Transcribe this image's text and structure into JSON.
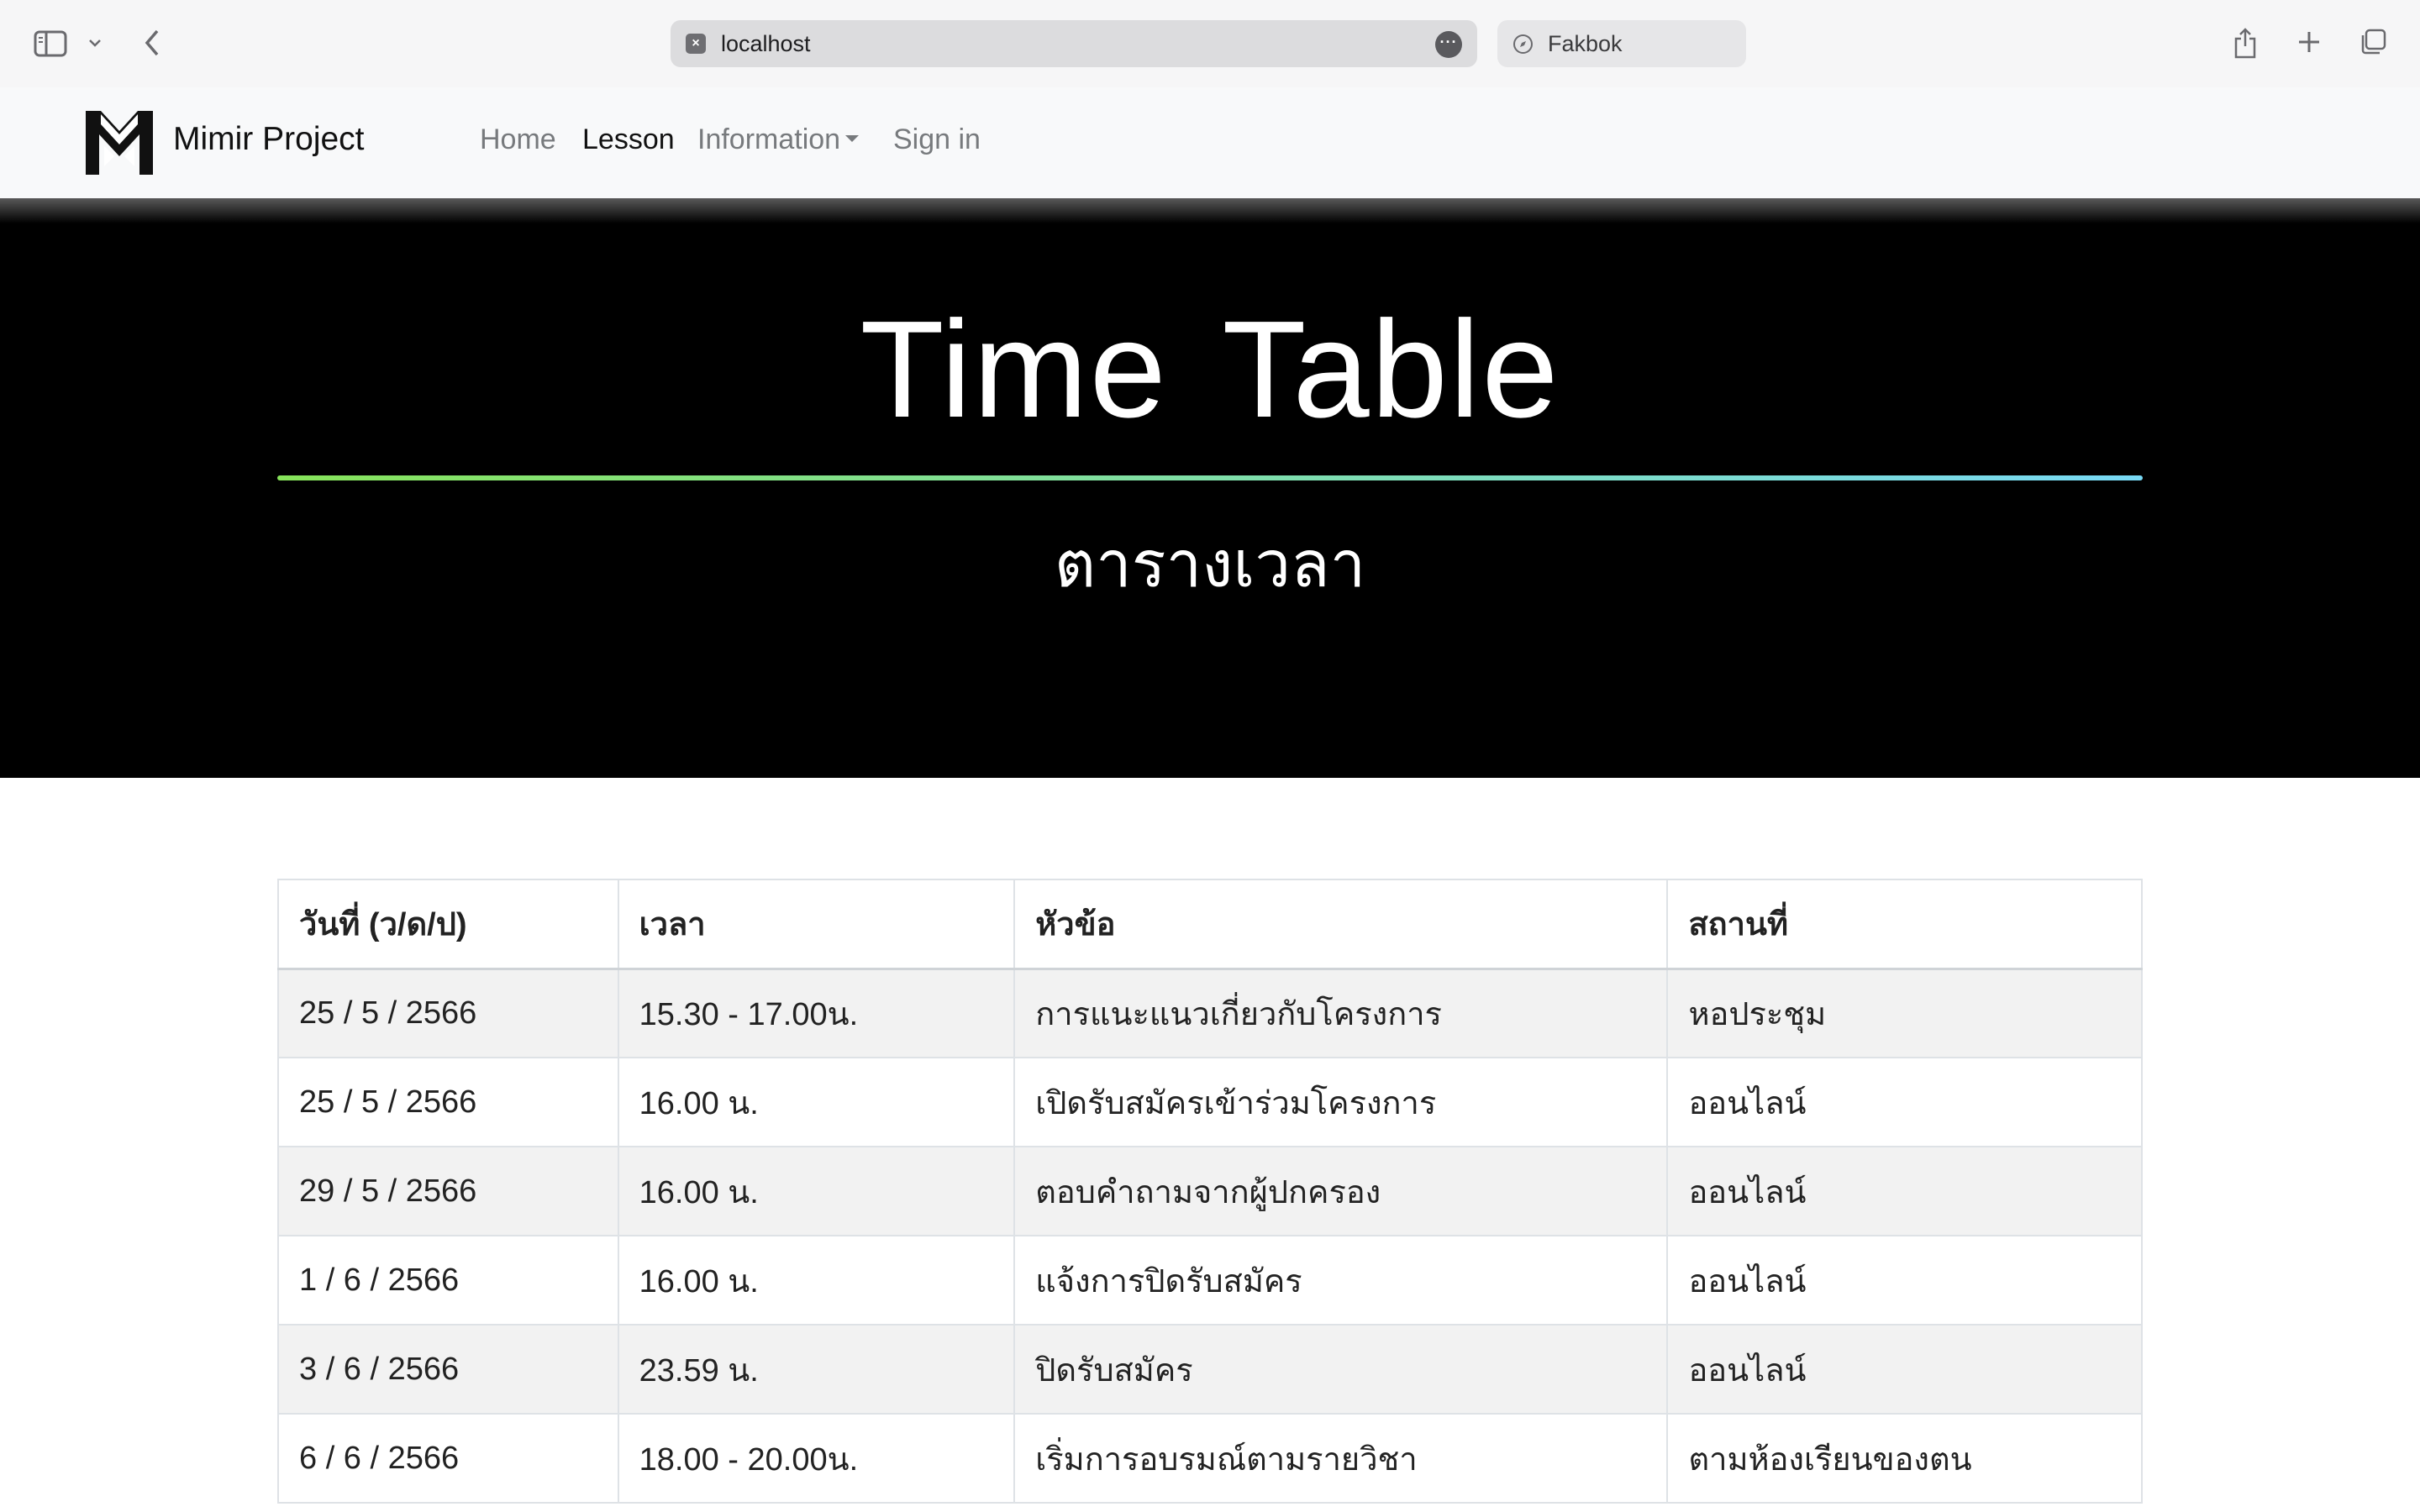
{
  "browser": {
    "url": "localhost",
    "second_tab": "Fakbok"
  },
  "navbar": {
    "brand": "Mimir Project",
    "links": [
      {
        "label": "Home",
        "active": false
      },
      {
        "label": "Lesson",
        "active": true
      },
      {
        "label": "Information",
        "active": false,
        "dropdown": true
      },
      {
        "label": "Sign in",
        "active": false
      }
    ]
  },
  "hero": {
    "title": "Time Table",
    "subtitle": "ตารางเวลา",
    "gradient_colors": [
      "#86e35a",
      "#78d9f5"
    ]
  },
  "table": {
    "headers": [
      "วันที่ (ว/ด/ป)",
      "เวลา",
      "หัวข้อ",
      "สถานที่"
    ],
    "rows": [
      [
        "25 / 5 / 2566",
        "15.30 - 17.00น.",
        "การแนะแนวเกี่ยวกับโครงการ",
        "หอประชุม"
      ],
      [
        "25 / 5 / 2566",
        "16.00 น.",
        "เปิดรับสมัครเข้าร่วมโครงการ",
        "ออนไลน์"
      ],
      [
        "29 / 5 / 2566",
        "16.00 น.",
        "ตอบคำถามจากผู้ปกครอง",
        "ออนไลน์"
      ],
      [
        "1 / 6 / 2566",
        "16.00 น.",
        "แจ้งการปิดรับสมัคร",
        "ออนไลน์"
      ],
      [
        "3 / 6 / 2566",
        "23.59 น.",
        "ปิดรับสมัคร",
        "ออนไลน์"
      ],
      [
        "6 / 6 / 2566",
        "18.00 - 20.00น.",
        "เริ่มการอบรมณ์ตามรายวิชา",
        "ตามห้องเรียนของตน"
      ]
    ]
  }
}
